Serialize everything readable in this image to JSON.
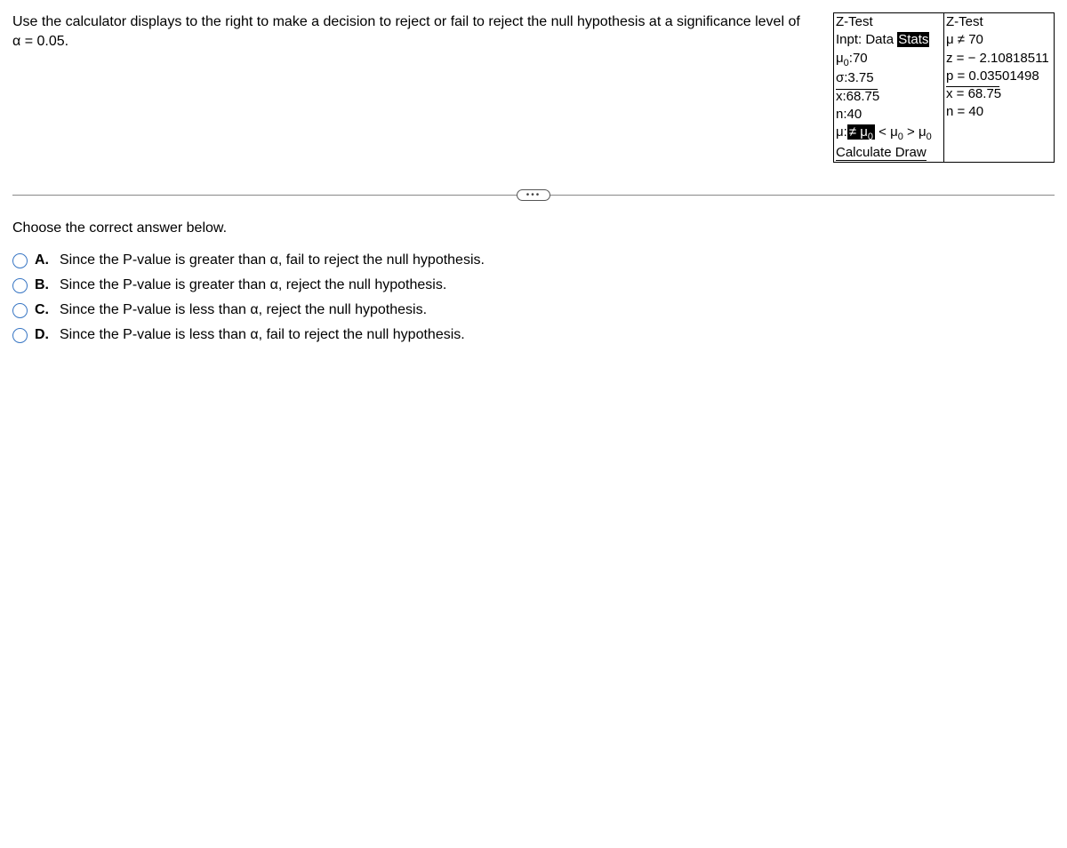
{
  "question": {
    "line1": "Use the calculator displays to the right to make a decision to reject or fail to reject the null hypothesis at a significance level of",
    "line2": "α = 0.05."
  },
  "calc_input": {
    "title": "Z-Test",
    "inpt_label": "Inpt: Data ",
    "stats": "Stats",
    "mu0_label": "μ",
    "mu0_sub": "0",
    "mu0_val": ":70",
    "sigma": "σ:3.75",
    "xbar": "x:68.75",
    "n": "n:40",
    "mu_prefix": "μ:",
    "mu_opt1": "≠ μ",
    "mu_opt1_sub": "0",
    "mu_opt2": " < μ",
    "mu_opt2_sub": "0",
    "mu_opt3": "  > μ",
    "mu_opt3_sub": "0",
    "calculate": "Calculate Draw"
  },
  "calc_output": {
    "title": "Z-Test",
    "alt": "μ ≠ 70",
    "z": "z = − 2.10818511",
    "p": "p = 0.03501498",
    "xbar": "x = 68.75",
    "n": "n = 40"
  },
  "collapse": "•••",
  "prompt": "Choose the correct answer below.",
  "options": {
    "a_letter": "A.",
    "a_text": "Since the P-value is greater than α, fail to reject the null hypothesis.",
    "b_letter": "B.",
    "b_text": "Since the P-value is greater than α, reject the null hypothesis.",
    "c_letter": "C.",
    "c_text": "Since the P-value is less than α, reject the null hypothesis.",
    "d_letter": "D.",
    "d_text": "Since the P-value is less than α, fail to reject the null hypothesis."
  }
}
